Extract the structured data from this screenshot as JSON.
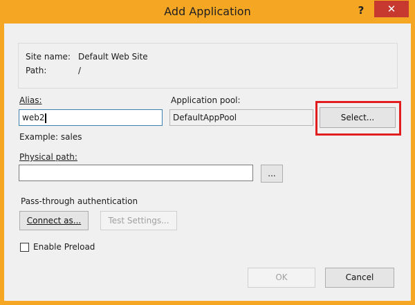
{
  "window": {
    "title": "Add Application",
    "help_glyph": "?",
    "close_glyph": "✕"
  },
  "info": {
    "site_name_label": "Site name:",
    "site_name_value": "Default Web Site",
    "path_label": "Path:",
    "path_value": "/"
  },
  "alias": {
    "label": "Alias:",
    "value": "web2",
    "example": "Example: sales"
  },
  "app_pool": {
    "label": "Application pool:",
    "value": "DefaultAppPool",
    "select_label": "Select..."
  },
  "physical_path": {
    "label": "Physical path:",
    "value": "",
    "browse_label": "..."
  },
  "auth": {
    "section_label": "Pass-through authentication",
    "connect_label": "Connect as...",
    "test_label": "Test Settings..."
  },
  "preload": {
    "label": "Enable Preload",
    "checked": false
  },
  "footer": {
    "ok_label": "OK",
    "cancel_label": "Cancel"
  },
  "colors": {
    "titlebar": "#f5a623",
    "close": "#c7382e",
    "highlight": "#e21d1d"
  }
}
